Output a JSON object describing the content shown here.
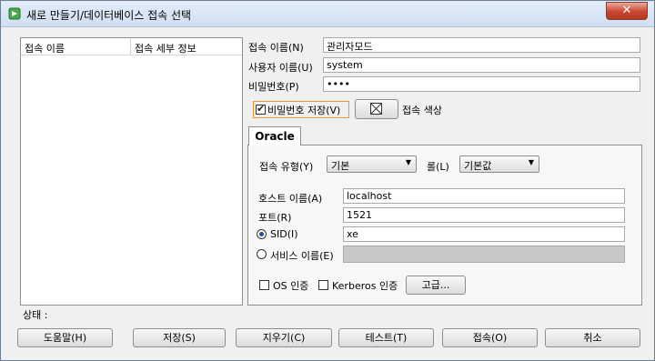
{
  "window": {
    "title": "새로 만들기/데이터베이스 접속 선택",
    "close_label": "✕"
  },
  "connections": {
    "columns": [
      "접속 이름",
      "접속 세부 정보"
    ]
  },
  "form": {
    "conn_name_label": "접속 이름(N)",
    "conn_name_value": "관리자모드",
    "user_label": "사용자 이름(U)",
    "user_value": "system",
    "password_label": "비밀번호(P)",
    "password_value": "••••",
    "save_password_label": "비밀번호 저장(V)",
    "save_password_checked": true,
    "color_label": "접속 색상"
  },
  "tabs": [
    {
      "label": "Oracle"
    }
  ],
  "oracle": {
    "conn_type_label": "접속 유형(Y)",
    "conn_type_value": "기본",
    "role_label": "롤(L)",
    "role_value": "기본값",
    "host_label": "호스트 이름(A)",
    "host_value": "localhost",
    "port_label": "포트(R)",
    "port_value": "1521",
    "sid_label": "SID(I)",
    "sid_value": "xe",
    "sid_selected": true,
    "service_label": "서비스 이름(E)",
    "service_value": "",
    "os_auth_label": "OS 인증",
    "kerberos_label": "Kerberos 인증",
    "advanced_label": "고급..."
  },
  "status": {
    "label": "상태 :"
  },
  "buttons": {
    "help": "도움말(H)",
    "save": "저장(S)",
    "clear": "지우기(C)",
    "test": "테스트(T)",
    "connect": "접속(O)",
    "cancel": "취소"
  }
}
